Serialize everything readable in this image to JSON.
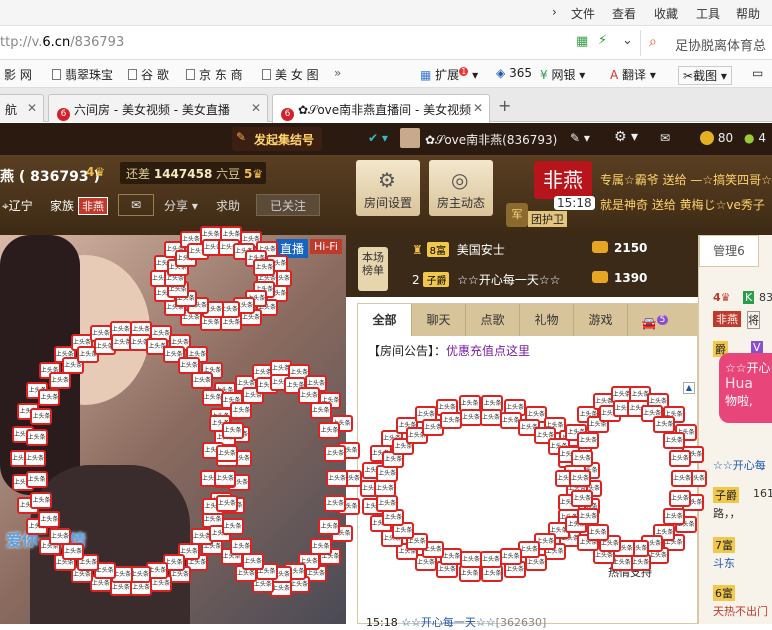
{
  "browser": {
    "menu": [
      "文件",
      "查看",
      "收藏",
      "工具",
      "帮助"
    ],
    "url_prefix": "ttp://v.",
    "url_domain": "6.cn",
    "url_path": "/836793",
    "search_text": "足协脱离体育总",
    "bookmarks": [
      "影 网",
      "翡翠珠宝",
      "谷 歌",
      "京 东 商",
      "美 女 图"
    ],
    "ext": {
      "kuozhan": "扩展",
      "badge": "1",
      "n365": "365",
      "wangyin": "网银",
      "fanyi": "翻译",
      "jietu": "截图"
    },
    "tabs": [
      {
        "label": "航",
        "closable": true
      },
      {
        "label": "六间房 - 美女视频 - 美女直播",
        "closable": true
      },
      {
        "label": "✿𝒮ove南非燕直播间 - 美女视频",
        "closable": true,
        "active": true
      }
    ],
    "new_tab": "+"
  },
  "site": {
    "jiejie": "发起集结号",
    "user": "✿𝒮ove南非燕(836793)",
    "coins": "80",
    "coins2": "4"
  },
  "room": {
    "name": "燕 ( 836793 )",
    "level": "4",
    "diff_label": "还差",
    "diff_value": "1447458",
    "diff_unit": "六豆",
    "next_level": "5",
    "location": "辽宁",
    "family_label": "家族",
    "family": "非燕",
    "share": "分享",
    "qiuzhu": "求助",
    "followed": "已关注",
    "btn_settings": "房间设置",
    "btn_dynamic": "房主动态",
    "guard_badge": "非燕",
    "guard_label": "团护卫",
    "ticker_time": "15:18",
    "ticker1": "专属☆霸爷 送给 —☆搞笑四哥☆",
    "ticker2": "就是神奇 送给 黄梅じ☆ve秀子"
  },
  "video": {
    "live": "直播",
    "hifi": "Hi-Fi",
    "caption": "爱你一生情"
  },
  "rank": {
    "title": "本场榜单",
    "rows": [
      {
        "pos": "",
        "badge": "8富",
        "name": "美国安士",
        "value": "2150"
      },
      {
        "pos": "2",
        "badge": "子爵",
        "name": "☆☆开心每一天☆☆",
        "value": "1390"
      }
    ]
  },
  "chat": {
    "tabs": [
      "全部",
      "聊天",
      "点歌",
      "礼物",
      "游戏"
    ],
    "car_count": "5",
    "notice_label": "【房间公告】",
    "notice_link": "优惠充值点这里",
    "line1_time": "15:18",
    "line1_name": "☆☆开心每一天☆☆",
    "line1_tail": "[362630]",
    "line_mid": "☆☆开心",
    "line_mid2": "热情支持",
    "line_up": "上"
  },
  "right": {
    "tab": "管理6",
    "items": [
      "4",
      "83",
      "非燕",
      "将",
      "爵",
      "V",
      "☆☆开心每",
      "子爵",
      "161",
      "路，，",
      "7富",
      "斗东",
      "6富",
      "天热不出门"
    ],
    "popup1": "☆☆开心",
    "popup2": "Hua",
    "popup3": "物啦,"
  },
  "sign_text": "上头条",
  "colors": {
    "dark_brown": "#2a1a10",
    "header": "#5a3f22",
    "accent_red": "#d22",
    "chat_tab": "#d8c49a",
    "link_purple": "#7a1fa2"
  }
}
